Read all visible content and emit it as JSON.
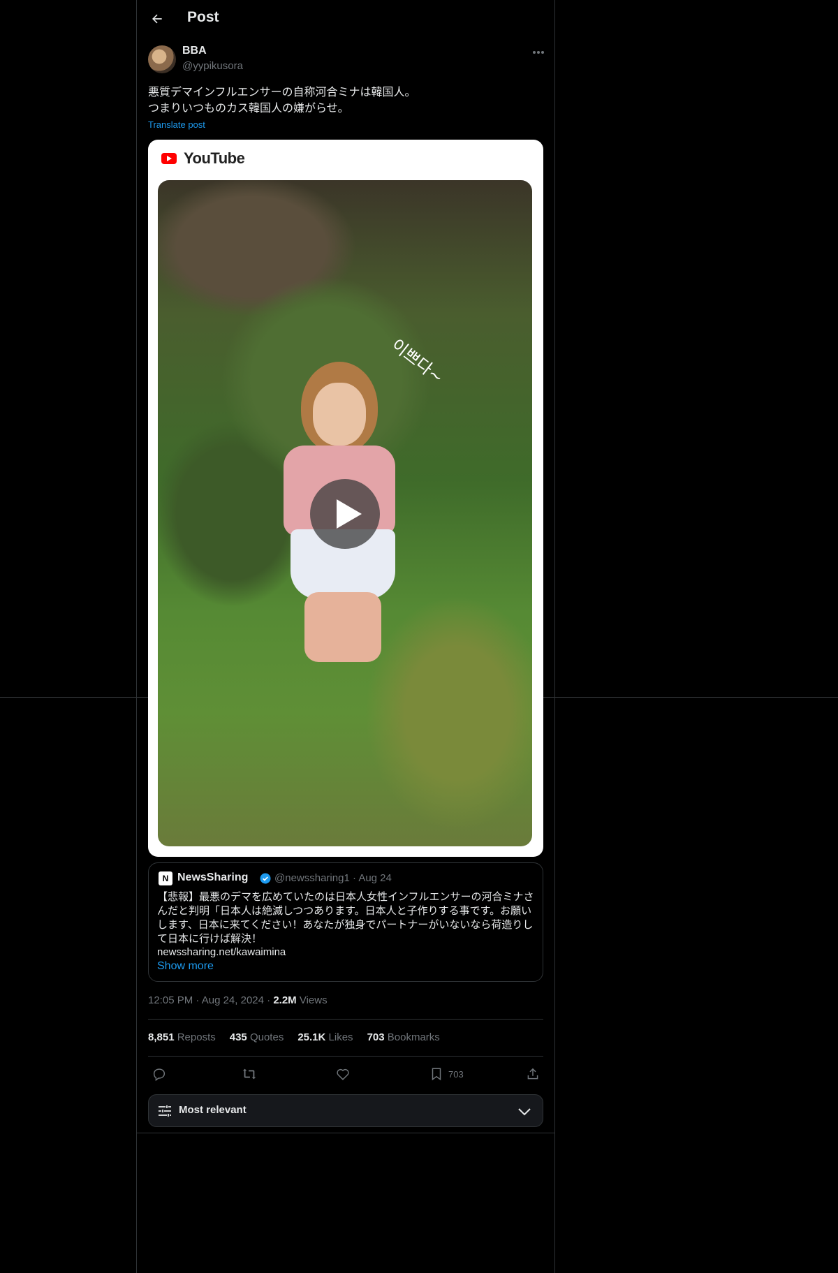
{
  "header": {
    "title": "Post"
  },
  "post": {
    "author_name": "BBA",
    "author_handle": "@yypikusora",
    "text": "悪質デマインフルエンサーの自称河合ミナは韓国人。\nつまりいつものカス韓国人の嫌がらせ。",
    "translate_label": "Translate post"
  },
  "media": {
    "source_label": "YouTube",
    "overlay_text": "이쁘다~"
  },
  "quoted": {
    "avatar_letter": "N",
    "name": "NewsSharing",
    "handle": "@newssharing1",
    "date": "Aug 24",
    "text": "【悲報】最悪のデマを広めていたのは日本人女性インフルエンサーの河合ミナさんだと判明「日本人は絶滅しつつあります。日本人と子作りする事です。お願いします、日本に来てください！あなたが独身でパートナーがいないなら荷造りして日本に行けば解決！",
    "link": "newssharing.net/kawaimina",
    "show_more": "Show more"
  },
  "meta": {
    "time": "12:05 PM",
    "date": "Aug 24, 2024",
    "views_count": "2.2M",
    "views_label": "Views"
  },
  "stats": {
    "reposts_count": "8,851",
    "reposts_label": "Reposts",
    "quotes_count": "435",
    "quotes_label": "Quotes",
    "likes_count": "25.1K",
    "likes_label": "Likes",
    "bookmarks_count": "703",
    "bookmarks_label": "Bookmarks"
  },
  "actions": {
    "bookmark_count": "703"
  },
  "sort": {
    "label": "Most relevant"
  },
  "icons": {
    "back": "arrow-left-icon",
    "more": "more-horizontal-icon",
    "verified": "verified-badge-icon",
    "reply": "reply-icon",
    "repost": "repost-icon",
    "like": "heart-icon",
    "bookmark": "bookmark-icon",
    "share": "share-icon",
    "sort": "sliders-icon",
    "chevron": "chevron-down-icon",
    "play": "play-icon"
  },
  "colors": {
    "accent": "#1d9bf0",
    "background": "#000000",
    "youtube_red": "#ff0000"
  }
}
